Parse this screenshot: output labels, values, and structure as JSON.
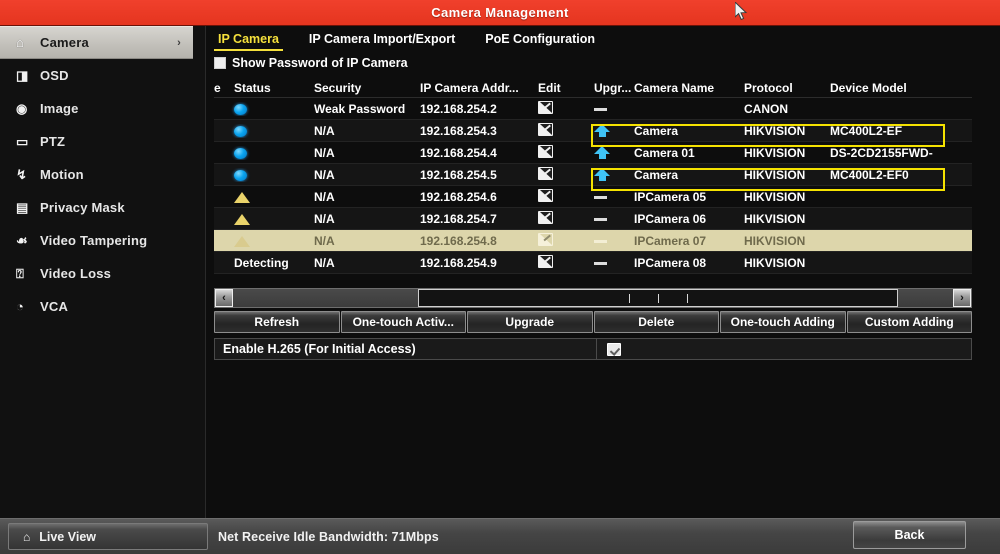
{
  "window": {
    "title": "Camera Management"
  },
  "sidebar": {
    "items": [
      {
        "label": "Camera",
        "icon": "camera-icon",
        "glyph": "⌂",
        "active": true,
        "chevron": "›"
      },
      {
        "label": "OSD",
        "icon": "osd-icon",
        "glyph": "◨",
        "active": false,
        "chevron": ""
      },
      {
        "label": "Image",
        "icon": "image-icon",
        "glyph": "◉",
        "active": false,
        "chevron": ""
      },
      {
        "label": "PTZ",
        "icon": "ptz-icon",
        "glyph": "▭",
        "active": false,
        "chevron": ""
      },
      {
        "label": "Motion",
        "icon": "motion-icon",
        "glyph": "↯",
        "active": false,
        "chevron": ""
      },
      {
        "label": "Privacy Mask",
        "icon": "privacy-mask-icon",
        "glyph": "▤",
        "active": false,
        "chevron": ""
      },
      {
        "label": "Video Tampering",
        "icon": "video-tampering-icon",
        "glyph": "☙",
        "active": false,
        "chevron": ""
      },
      {
        "label": "Video Loss",
        "icon": "video-loss-icon",
        "glyph": "⍰",
        "active": false,
        "chevron": ""
      },
      {
        "label": "VCA",
        "icon": "vca-icon",
        "glyph": "◔",
        "active": false,
        "chevron": ""
      }
    ],
    "live_view": {
      "label": "Live View",
      "icon": "home-icon",
      "glyph": "⌂"
    }
  },
  "tabs": [
    {
      "label": "IP Camera",
      "active": true
    },
    {
      "label": "IP Camera Import/Export",
      "active": false
    },
    {
      "label": "PoE Configuration",
      "active": false
    }
  ],
  "show_password": {
    "label": "Show Password of IP Camera",
    "checked": false
  },
  "table": {
    "headers": {
      "e": "e",
      "status": "Status",
      "security": "Security",
      "address": "IP Camera Addr...",
      "edit": "Edit",
      "upgrade": "Upgr...",
      "name": "Camera Name",
      "protocol": "Protocol",
      "model": "Device Model"
    },
    "rows": [
      {
        "status_icon": "blue-dot",
        "status_text": "",
        "security": "Weak Password",
        "address": "192.168.254.2",
        "edit_icon": "edit-pencil-icon",
        "upgrade_icon": "dash",
        "name": "",
        "protocol": "CANON",
        "model": "",
        "selected": false,
        "highlight": false
      },
      {
        "status_icon": "blue-dot",
        "status_text": "",
        "security": "N/A",
        "address": "192.168.254.3",
        "edit_icon": "edit-pencil-icon",
        "upgrade_icon": "arrow-up",
        "name": "Camera",
        "protocol": "HIKVISION",
        "model": "MC400L2-EF",
        "selected": false,
        "highlight": true
      },
      {
        "status_icon": "blue-dot",
        "status_text": "",
        "security": "N/A",
        "address": "192.168.254.4",
        "edit_icon": "edit-pencil-icon",
        "upgrade_icon": "arrow-up",
        "name": "Camera 01",
        "protocol": "HIKVISION",
        "model": "DS-2CD2155FWD-",
        "selected": false,
        "highlight": false
      },
      {
        "status_icon": "blue-dot",
        "status_text": "",
        "security": "N/A",
        "address": "192.168.254.5",
        "edit_icon": "edit-pencil-icon",
        "upgrade_icon": "arrow-up",
        "name": "Camera",
        "protocol": "HIKVISION",
        "model": "MC400L2-EF0",
        "selected": false,
        "highlight": true
      },
      {
        "status_icon": "yellow-triangle",
        "status_text": "",
        "security": "N/A",
        "address": "192.168.254.6",
        "edit_icon": "edit-pencil-icon",
        "upgrade_icon": "dash",
        "name": "IPCamera 05",
        "protocol": "HIKVISION",
        "model": "",
        "selected": false,
        "highlight": false
      },
      {
        "status_icon": "yellow-triangle",
        "status_text": "",
        "security": "N/A",
        "address": "192.168.254.7",
        "edit_icon": "edit-pencil-icon",
        "upgrade_icon": "dash",
        "name": "IPCamera 06",
        "protocol": "HIKVISION",
        "model": "",
        "selected": false,
        "highlight": false
      },
      {
        "status_icon": "yellow-triangle",
        "status_text": "",
        "security": "N/A",
        "address": "192.168.254.8",
        "edit_icon": "edit-pencil-icon",
        "upgrade_icon": "dash",
        "name": "IPCamera 07",
        "protocol": "HIKVISION",
        "model": "",
        "selected": true,
        "highlight": false
      },
      {
        "status_icon": "none",
        "status_text": "Detecting",
        "security": "N/A",
        "address": "192.168.254.9",
        "edit_icon": "edit-pencil-icon",
        "upgrade_icon": "dash",
        "name": "IPCamera 08",
        "protocol": "HIKVISION",
        "model": "",
        "selected": false,
        "highlight": false
      }
    ]
  },
  "scrollbar": {
    "left_arrow": "‹",
    "right_arrow": "›"
  },
  "actions": [
    {
      "label": "Refresh"
    },
    {
      "label": "One-touch Activ..."
    },
    {
      "label": "Upgrade"
    },
    {
      "label": "Delete"
    },
    {
      "label": "One-touch Adding"
    },
    {
      "label": "Custom Adding"
    }
  ],
  "h265": {
    "label": "Enable H.265 (For Initial Access)",
    "checked": true
  },
  "status_bar": {
    "bandwidth": "Net Receive Idle Bandwidth: 71Mbps",
    "back_label": "Back"
  },
  "colors": {
    "title_bar": "#ee3d2b",
    "accent_tab": "#f5e03c",
    "highlight_box": "#f5e200",
    "selected_row": "#ddd6ab",
    "status_ok": "#0aa4ef",
    "status_warn": "#ead36a"
  }
}
